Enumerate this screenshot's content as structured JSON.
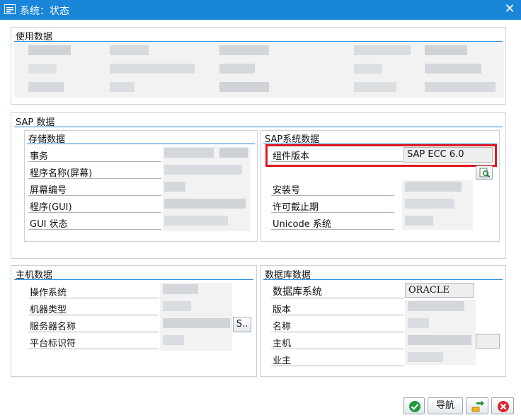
{
  "window": {
    "title": "系统：状态"
  },
  "usage": {
    "title": "使用数据"
  },
  "sap": {
    "title": "SAP 数据",
    "storage": {
      "title": "存储数据",
      "rows": [
        "事务",
        "程序名称(屏幕)",
        "屏幕编号",
        "程序(GUI)",
        "GUI 状态"
      ]
    },
    "system": {
      "title": "SAP系统数据",
      "component_label": "组件版本",
      "component_value": "SAP ECC 6.0",
      "rows": [
        "安装号",
        "许可截止期",
        "Unicode 系统"
      ]
    }
  },
  "host": {
    "title": "主机数据",
    "rows": [
      "操作系统",
      "机器类型",
      "服务器名称",
      "平台标识符"
    ],
    "more_label": "S.."
  },
  "db": {
    "title": "数据库数据",
    "rows": [
      "数据库系统",
      "版本",
      "名称",
      "主机",
      "业主"
    ],
    "system_value": "ORACLE"
  },
  "footer": {
    "nav_label": "导航"
  },
  "colors": {
    "titlebar": "#1a86d9",
    "accent_line": "#1e88d8",
    "highlight": "#e0191f",
    "confirm": "#1f9a3a",
    "cancel": "#d9262c"
  }
}
